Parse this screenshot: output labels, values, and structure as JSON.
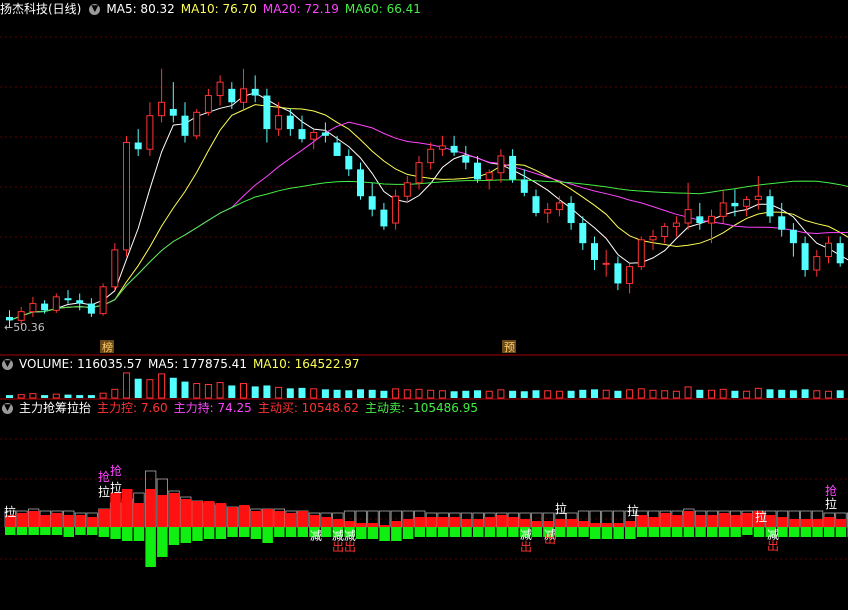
{
  "header": {
    "stock_title": "扬杰科技(日线)",
    "ma": [
      {
        "text": "MA5: 80.32",
        "color": "#ffffff"
      },
      {
        "text": "MA10: 76.70",
        "color": "#ffff55"
      },
      {
        "text": "MA20: 72.19",
        "color": "#ff44ff"
      },
      {
        "text": "MA60: 66.41",
        "color": "#44ee44"
      }
    ]
  },
  "price_panel": {
    "low_marker": "←50.36",
    "signals": [
      "榜",
      "预"
    ]
  },
  "volume_panel": {
    "label": "VOLUME: 116035.57",
    "ma5": "MA5: 177875.41",
    "ma10": "MA10: 164522.97",
    "colors": {
      "label": "#ffffff",
      "ma5": "#ffffff",
      "ma10": "#ffff55"
    }
  },
  "indicator_panel": {
    "title": "主力抢筹拉抬",
    "items": [
      {
        "text": "主力控: 7.60",
        "color": "#ff3333"
      },
      {
        "text": "主力持: 74.25",
        "color": "#ff44ff"
      },
      {
        "text": "主动买: 10548.62",
        "color": "#ff3333"
      },
      {
        "text": "主动卖: -105486.95",
        "color": "#44ee44"
      }
    ],
    "markers": {
      "la": "拉",
      "qiang": "抢",
      "jian": "减",
      "chu": "出"
    }
  },
  "chart_data": {
    "type": "candlestick",
    "price_range": [
      50.36,
      90
    ],
    "candles": [
      [
        52,
        53,
        50.4,
        51.5
      ],
      [
        51.5,
        53.5,
        50.8,
        52.8
      ],
      [
        52.8,
        55,
        52,
        54
      ],
      [
        54,
        54.5,
        52.5,
        53
      ],
      [
        53,
        55.5,
        52.6,
        55
      ],
      [
        54.8,
        56,
        54,
        54.5
      ],
      [
        54.5,
        55.5,
        53,
        54
      ],
      [
        54,
        54.8,
        52,
        52.5
      ],
      [
        52.5,
        57,
        52.2,
        56.5
      ],
      [
        56.5,
        63,
        56,
        62
      ],
      [
        62,
        79,
        61,
        78
      ],
      [
        78,
        80,
        76,
        77
      ],
      [
        77,
        84,
        76,
        82
      ],
      [
        82,
        89,
        81,
        84
      ],
      [
        83,
        87,
        81,
        82
      ],
      [
        82,
        84,
        78,
        79
      ],
      [
        79,
        83,
        78.5,
        82.5
      ],
      [
        82.5,
        86,
        82,
        85
      ],
      [
        85,
        88,
        83.5,
        87
      ],
      [
        86,
        87,
        83,
        84
      ],
      [
        84,
        89,
        83,
        86
      ],
      [
        86,
        88,
        84,
        85
      ],
      [
        85,
        86,
        78,
        80
      ],
      [
        80,
        84,
        79,
        82
      ],
      [
        82,
        83,
        79,
        80
      ],
      [
        80,
        82,
        78,
        78.5
      ],
      [
        78.5,
        80,
        77,
        79.5
      ],
      [
        79.5,
        81,
        78,
        79
      ],
      [
        78,
        79,
        76,
        76
      ],
      [
        76,
        77,
        73,
        74
      ],
      [
        74,
        75,
        69.5,
        70
      ],
      [
        70,
        72,
        67,
        68
      ],
      [
        68,
        69,
        65,
        65.5
      ],
      [
        66,
        71,
        65,
        70
      ],
      [
        70,
        73,
        69,
        72
      ],
      [
        72,
        76,
        71,
        75
      ],
      [
        75,
        78,
        74,
        77
      ],
      [
        77,
        79,
        76,
        77.5
      ],
      [
        77.5,
        79,
        76,
        76.5
      ],
      [
        76,
        77.5,
        74,
        75
      ],
      [
        75,
        76,
        72,
        72.5
      ],
      [
        72.5,
        74,
        71,
        73.5
      ],
      [
        73.5,
        77,
        72,
        76
      ],
      [
        76,
        77,
        72,
        72.5
      ],
      [
        72.5,
        74,
        70,
        70.5
      ],
      [
        70,
        71,
        67,
        67.5
      ],
      [
        67.5,
        69,
        66,
        68
      ],
      [
        68,
        70,
        67,
        69
      ],
      [
        69,
        70,
        65,
        66
      ],
      [
        66,
        67,
        62,
        63
      ],
      [
        63,
        64,
        59,
        60.5
      ],
      [
        60,
        62,
        58,
        60
      ],
      [
        60,
        61,
        56,
        57
      ],
      [
        57,
        60,
        55.5,
        59.5
      ],
      [
        59.5,
        64,
        59,
        63.5
      ],
      [
        63.5,
        65,
        62,
        64
      ],
      [
        64,
        66,
        63,
        65.5
      ],
      [
        65.5,
        67,
        64,
        66
      ],
      [
        66,
        72,
        65,
        68
      ],
      [
        67,
        69,
        65,
        66
      ],
      [
        66,
        68,
        63,
        67
      ],
      [
        67,
        71,
        66,
        69
      ],
      [
        69,
        71,
        67,
        68.5
      ],
      [
        68.5,
        70,
        67,
        69.5
      ],
      [
        69.5,
        73,
        68,
        70
      ],
      [
        70,
        71,
        66,
        67
      ],
      [
        67,
        69,
        64,
        65
      ],
      [
        65,
        66,
        61,
        63
      ],
      [
        63,
        64,
        58,
        59
      ],
      [
        59,
        62,
        58,
        61
      ],
      [
        61,
        64,
        60,
        63
      ],
      [
        63,
        64,
        59.5,
        60
      ],
      [
        60,
        62,
        57,
        58
      ],
      [
        58,
        62,
        57.5,
        61
      ],
      [
        61,
        65,
        60,
        64
      ],
      [
        64,
        65,
        59,
        60.5
      ],
      [
        60.5,
        63,
        59.5,
        62
      ],
      [
        62,
        63,
        59,
        59.5
      ],
      [
        59.5,
        60,
        57,
        58
      ],
      [
        58,
        61,
        55,
        60
      ],
      [
        61,
        72,
        60,
        71
      ],
      [
        71,
        72,
        68,
        69
      ]
    ],
    "volume_range": [
      0,
      560000
    ],
    "volumes": [
      60000,
      70000,
      90000,
      60000,
      80000,
      70000,
      60000,
      60000,
      100000,
      180000,
      520000,
      400000,
      380000,
      500000,
      420000,
      340000,
      300000,
      280000,
      320000,
      260000,
      300000,
      240000,
      260000,
      220000,
      200000,
      210000,
      190000,
      180000,
      170000,
      160000,
      180000,
      170000,
      150000,
      190000,
      170000,
      180000,
      160000,
      150000,
      140000,
      150000,
      160000,
      140000,
      170000,
      150000,
      140000,
      160000,
      150000,
      140000,
      150000,
      170000,
      180000,
      160000,
      150000,
      170000,
      190000,
      160000,
      150000,
      140000,
      230000,
      170000,
      160000,
      180000,
      150000,
      140000,
      200000,
      180000,
      170000,
      160000,
      180000,
      150000,
      140000,
      160000,
      170000,
      150000,
      180000,
      170000,
      150000,
      140000,
      150000,
      170000,
      260000,
      180000
    ],
    "indicator": {
      "zero_level": 0,
      "range": [
        -40,
        45
      ],
      "bars": [
        [
          6,
          -4
        ],
        [
          7,
          -4
        ],
        [
          8,
          -4
        ],
        [
          6,
          -4
        ],
        [
          7,
          -4
        ],
        [
          6,
          -5
        ],
        [
          6,
          -4
        ],
        [
          5,
          -4
        ],
        [
          9,
          -5
        ],
        [
          17,
          -6
        ],
        [
          19,
          -7
        ],
        [
          12,
          -7
        ],
        [
          19,
          -20
        ],
        [
          16,
          -15
        ],
        [
          17,
          -9
        ],
        [
          14,
          -8
        ],
        [
          13,
          -7
        ],
        [
          13,
          -6
        ],
        [
          12,
          -6
        ],
        [
          10,
          -5
        ],
        [
          11,
          -5
        ],
        [
          8,
          -6
        ],
        [
          9,
          -8
        ],
        [
          8,
          -5
        ],
        [
          7,
          -5
        ],
        [
          8,
          -5
        ],
        [
          6,
          -5
        ],
        [
          5,
          -5
        ],
        [
          4,
          -5
        ],
        [
          3,
          -5
        ],
        [
          2,
          -6
        ],
        [
          2,
          -6
        ],
        [
          1,
          -7
        ],
        [
          3,
          -7
        ],
        [
          4,
          -6
        ],
        [
          5,
          -5
        ],
        [
          5,
          -5
        ],
        [
          5,
          -5
        ],
        [
          5,
          -5
        ],
        [
          4,
          -5
        ],
        [
          4,
          -5
        ],
        [
          5,
          -5
        ],
        [
          6,
          -5
        ],
        [
          5,
          -5
        ],
        [
          4,
          -5
        ],
        [
          3,
          -5
        ],
        [
          3,
          -5
        ],
        [
          4,
          -5
        ],
        [
          4,
          -5
        ],
        [
          3,
          -5
        ],
        [
          2,
          -6
        ],
        [
          2,
          -6
        ],
        [
          2,
          -6
        ],
        [
          3,
          -6
        ],
        [
          6,
          -5
        ],
        [
          5,
          -5
        ],
        [
          7,
          -5
        ],
        [
          6,
          -5
        ],
        [
          8,
          -5
        ],
        [
          6,
          -5
        ],
        [
          6,
          -5
        ],
        [
          7,
          -5
        ],
        [
          6,
          -5
        ],
        [
          7,
          -4
        ],
        [
          8,
          -5
        ],
        [
          6,
          -5
        ],
        [
          5,
          -5
        ],
        [
          4,
          -5
        ],
        [
          4,
          -5
        ],
        [
          4,
          -5
        ],
        [
          5,
          -5
        ],
        [
          4,
          -5
        ],
        [
          4,
          -5
        ],
        [
          5,
          -5
        ],
        [
          6,
          -5
        ],
        [
          4,
          -5
        ],
        [
          4,
          -5
        ],
        [
          3,
          -5
        ],
        [
          3,
          -5
        ],
        [
          6,
          -5
        ],
        [
          9,
          -5
        ],
        [
          7,
          -5
        ]
      ],
      "outlines": [
        [
          5,
          8
        ],
        [
          6,
          8
        ],
        [
          7,
          9
        ],
        [
          6,
          8
        ],
        [
          6,
          8
        ],
        [
          6,
          8
        ],
        [
          6,
          7
        ],
        [
          5,
          7
        ],
        [
          8,
          9
        ],
        [
          10,
          12
        ],
        [
          12,
          14
        ],
        [
          15,
          17
        ],
        [
          26,
          28
        ],
        [
          22,
          24
        ],
        [
          16,
          18
        ],
        [
          14,
          15
        ],
        [
          12,
          13
        ],
        [
          11,
          12
        ],
        [
          10,
          11
        ],
        [
          9,
          10
        ],
        [
          9,
          10
        ],
        [
          8,
          9
        ],
        [
          8,
          9
        ],
        [
          8,
          9
        ],
        [
          7,
          8
        ],
        [
          7,
          8
        ],
        [
          6,
          7
        ],
        [
          6,
          7
        ],
        [
          6,
          7
        ],
        [
          7,
          8
        ],
        [
          7,
          8
        ],
        [
          7,
          8
        ],
        [
          7,
          8
        ],
        [
          7,
          8
        ],
        [
          7,
          8
        ],
        [
          7,
          8
        ],
        [
          6,
          7
        ],
        [
          6,
          7
        ],
        [
          6,
          7
        ],
        [
          6,
          7
        ],
        [
          6,
          7
        ],
        [
          6,
          7
        ],
        [
          6,
          7
        ],
        [
          6,
          7
        ],
        [
          6,
          7
        ],
        [
          6,
          7
        ],
        [
          6,
          7
        ],
        [
          6,
          7
        ],
        [
          6,
          7
        ],
        [
          6,
          8
        ],
        [
          6,
          8
        ],
        [
          6,
          8
        ],
        [
          6,
          8
        ],
        [
          6,
          8
        ],
        [
          7,
          8
        ],
        [
          7,
          8
        ],
        [
          7,
          8
        ],
        [
          7,
          8
        ],
        [
          8,
          9
        ],
        [
          7,
          8
        ],
        [
          7,
          8
        ],
        [
          7,
          8
        ],
        [
          7,
          8
        ],
        [
          7,
          8
        ],
        [
          7,
          8
        ],
        [
          7,
          8
        ],
        [
          7,
          8
        ],
        [
          7,
          8
        ],
        [
          7,
          8
        ],
        [
          7,
          8
        ],
        [
          6,
          7
        ],
        [
          6,
          7
        ],
        [
          6,
          7
        ],
        [
          6,
          7
        ],
        [
          6,
          7
        ],
        [
          6,
          7
        ],
        [
          6,
          7
        ],
        [
          6,
          7
        ],
        [
          6,
          7
        ],
        [
          6,
          7
        ],
        [
          7,
          8
        ],
        [
          7,
          8
        ]
      ]
    }
  }
}
